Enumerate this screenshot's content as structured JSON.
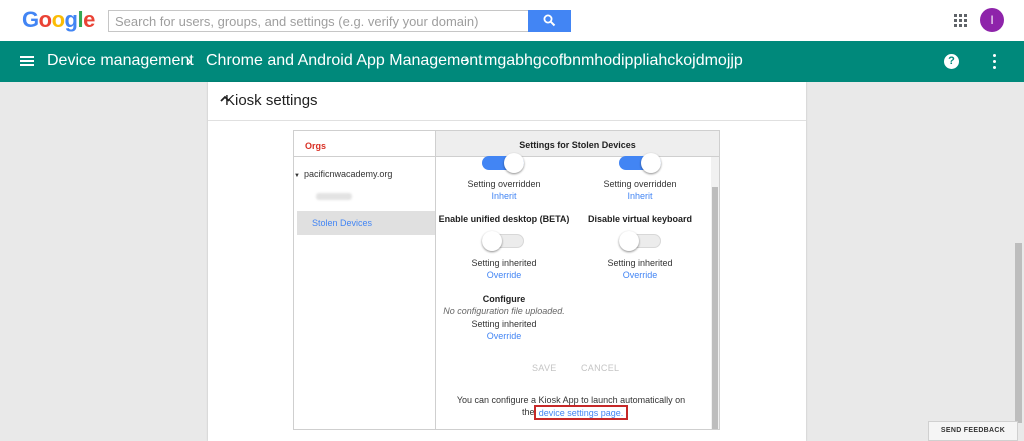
{
  "topbar": {
    "logo": {
      "letters": [
        "G",
        "o",
        "o",
        "g",
        "l",
        "e"
      ],
      "colors": [
        "#4285f4",
        "#ea4335",
        "#fbbc05",
        "#4285f4",
        "#34a853",
        "#ea4335"
      ]
    },
    "search": {
      "placeholder": "Search for users, groups, and settings (e.g. verify your domain)",
      "value": "",
      "button_icon": "search-icon"
    },
    "apps_icon": "apps-grid-icon",
    "avatar_initial": "I"
  },
  "header": {
    "menu_icon": "hamburger-menu-icon",
    "breadcrumbs": [
      "Device management",
      "Chrome and Android App Management",
      "mgabhgcofbnmhodippliahckojdmojjp"
    ],
    "separator": "›",
    "help_icon": "help-icon",
    "more_icon": "more-vert-icon",
    "bg_color": "#00897b"
  },
  "section": {
    "title": "Kiosk settings",
    "expand_icon": "chevron-up-icon"
  },
  "orgs": {
    "heading": "Orgs",
    "root": "pacificnwacademy.org",
    "selected": "Stolen Devices"
  },
  "settings": {
    "heading": "Settings for Stolen Devices",
    "top_left": {
      "toggle": "on",
      "status": "Setting overridden",
      "action": "Inherit"
    },
    "top_right": {
      "toggle": "on",
      "status": "Setting overridden",
      "action": "Inherit"
    },
    "unified_desktop": {
      "label": "Enable unified desktop (BETA)",
      "toggle": "off",
      "status": "Setting inherited",
      "action": "Override"
    },
    "virtual_keyboard": {
      "label": "Disable virtual keyboard",
      "toggle": "off",
      "status": "Setting inherited",
      "action": "Override"
    },
    "configure": {
      "label": "Configure",
      "note": "No configuration file uploaded.",
      "status": "Setting inherited",
      "action": "Override"
    },
    "save_label": "SAVE",
    "cancel_label": "CANCEL",
    "footer_text": "You can configure a Kiosk App to launch automatically on",
    "footer_prefix": "the",
    "footer_link": "device settings page.",
    "highlight_color": "#c62828"
  },
  "feedback_label": "SEND FEEDBACK"
}
